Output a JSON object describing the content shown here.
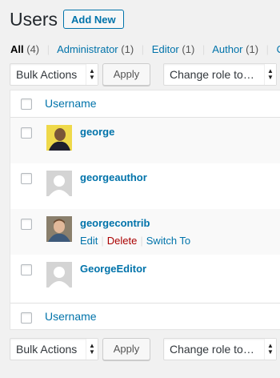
{
  "header": {
    "title": "Users",
    "add_new_label": "Add New"
  },
  "filters": [
    {
      "label": "All",
      "count": "(4)"
    },
    {
      "label": "Administrator",
      "count": "(1)"
    },
    {
      "label": "Editor",
      "count": "(1)"
    },
    {
      "label": "Author",
      "count": "(1)"
    },
    {
      "label": "Co",
      "count": ""
    }
  ],
  "tablenav_top": {
    "bulk_actions": "Bulk Actions",
    "apply": "Apply",
    "change_role": "Change role to…"
  },
  "tablenav_bottom": {
    "bulk_actions": "Bulk Actions",
    "apply": "Apply",
    "change_role": "Change role to…"
  },
  "table": {
    "column_username": "Username",
    "rows": [
      {
        "username": "george",
        "avatar": "photo-avatar-icon"
      },
      {
        "username": "georgeauthor",
        "avatar": "default-avatar-icon"
      },
      {
        "username": "georgecontrib",
        "avatar": "photo-avatar-icon",
        "actions": {
          "edit": "Edit",
          "delete": "Delete",
          "switch": "Switch To"
        }
      },
      {
        "username": "GeorgeEditor",
        "avatar": "default-avatar-icon"
      }
    ]
  },
  "colors": {
    "link": "#0073aa",
    "delete": "#a00000",
    "bg": "#f1f1f1"
  }
}
